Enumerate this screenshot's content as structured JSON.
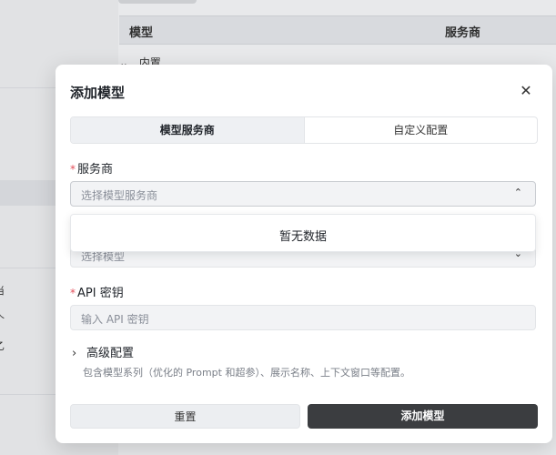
{
  "background": {
    "table_header": {
      "col_model": "模型",
      "col_provider": "服务商"
    },
    "group_label": "内置",
    "sidebar_fragments": [
      "当",
      "个",
      "乙"
    ]
  },
  "modal": {
    "title": "添加模型",
    "close_icon": "close-icon",
    "tabs": [
      {
        "label": "模型服务商",
        "active": true
      },
      {
        "label": "自定义配置",
        "active": false
      }
    ],
    "provider": {
      "label": "服务商",
      "required_mark": "*",
      "placeholder": "选择模型服务商",
      "dropdown_empty": "暂无数据"
    },
    "model": {
      "placeholder": "选择模型"
    },
    "api_key": {
      "label": "API 密钥",
      "required_mark": "*",
      "placeholder": "输入 API 密钥"
    },
    "advanced": {
      "label": "高级配置",
      "description": "包含模型系列（优化的 Prompt 和超参）、展示名称、上下文窗口等配置。"
    },
    "buttons": {
      "reset": "重置",
      "submit": "添加模型"
    }
  },
  "colors": {
    "primary_button": "#3b3d40",
    "required": "#e34d59"
  }
}
